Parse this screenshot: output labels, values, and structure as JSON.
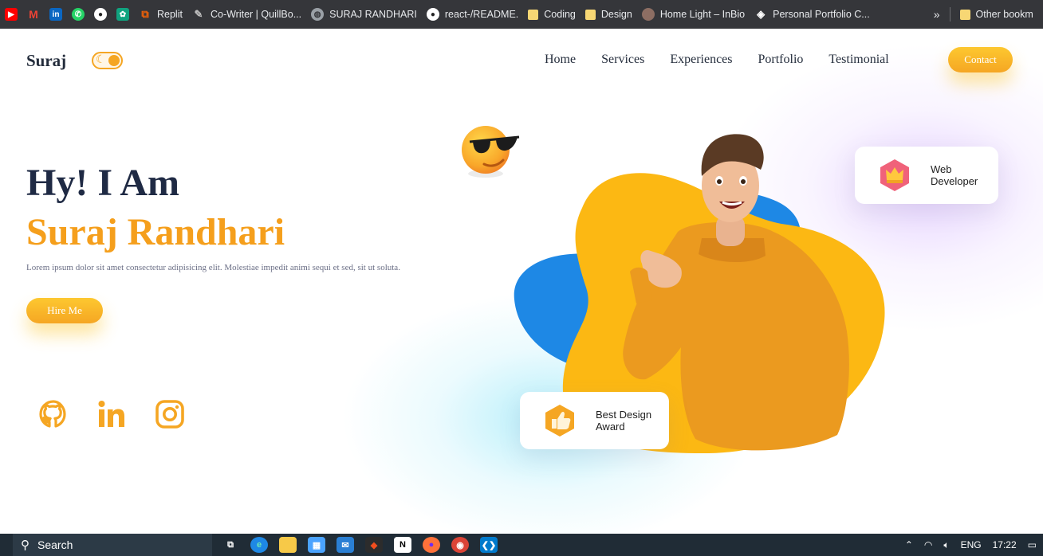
{
  "bookmarks": [
    {
      "label": "",
      "icon": "youtube-icon",
      "color": "#ff0000"
    },
    {
      "label": "",
      "icon": "gmail-icon",
      "color": "#ea4335"
    },
    {
      "label": "",
      "icon": "linkedin-icon",
      "color": "#0a66c2"
    },
    {
      "label": "",
      "icon": "whatsapp-icon",
      "color": "#25d366"
    },
    {
      "label": "",
      "icon": "github-icon",
      "color": "#ffffff"
    },
    {
      "label": "",
      "icon": "chatgpt-icon",
      "color": "#10a37f"
    },
    {
      "label": "Replit",
      "icon": "replit-icon",
      "color": "#f26207"
    },
    {
      "label": "Co-Writer | QuillBo...",
      "icon": "quill-icon",
      "color": "#bdbdbd"
    },
    {
      "label": "SURAJ RANDHARI",
      "icon": "globe-icon",
      "color": "#9aa0a6"
    },
    {
      "label": "react-/README.",
      "icon": "github-icon",
      "color": "#ffffff"
    },
    {
      "label": "Coding",
      "icon": "folder-icon",
      "color": "#f7d774"
    },
    {
      "label": "Design",
      "icon": "folder-icon",
      "color": "#f7d774"
    },
    {
      "label": "Home Light – InBio",
      "icon": "avatar-icon",
      "color": "#8d6e63"
    },
    {
      "label": "Personal Portfolio C...",
      "icon": "codepen-icon",
      "color": "#ffffff"
    }
  ],
  "bookmarks_overflow": "»",
  "other_bookmarks": "Other bookm",
  "site": {
    "logo": "Suraj",
    "nav": [
      "Home",
      "Services",
      "Experiences",
      "Portfolio",
      "Testimonial"
    ],
    "contact_button": "Contact",
    "hero_line1": "Hy! I Am",
    "hero_line2": "Suraj Randhari",
    "description": "Lorem ipsum dolor sit amet consectetur adipisicing elit. Molestiae impedit animi sequi et sed, sit ut soluta.",
    "hire_button": "Hire Me",
    "socials": [
      "github-icon",
      "linkedin-icon",
      "instagram-icon"
    ],
    "card_web": "Web Developer",
    "card_award": "Best Design Award",
    "accent_color": "#f5a623",
    "heading_color": "#1f2a44"
  },
  "taskbar": {
    "search_placeholder": "Search",
    "language": "ENG",
    "time": "17:22"
  }
}
